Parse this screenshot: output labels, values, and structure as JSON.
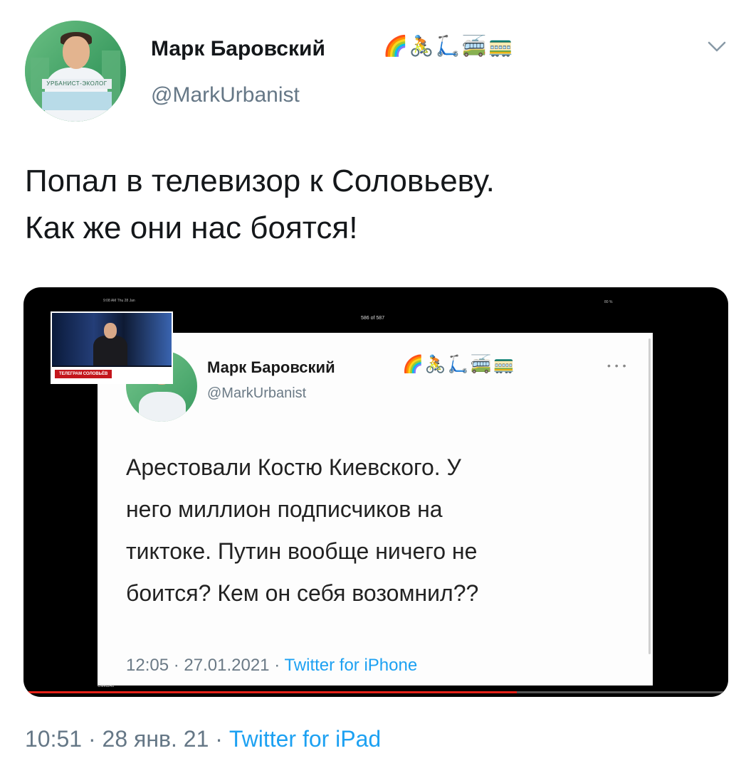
{
  "author": {
    "name": "Марк Баровский",
    "emojis": "🌈🚴🛴🚎🚃",
    "handle": "@MarkUrbanist",
    "avatar_badge": "УРБАНИСТ-ЭКОЛОГ"
  },
  "tweet": {
    "text": "Попал в телевизор к Соловьеву.\nКак же они нас боятся!",
    "time": "10:51",
    "date": "28 янв. 21",
    "separator": "·",
    "source": "Twitter for iPad"
  },
  "media": {
    "status_left": "9:08 AM  Thu 28 Jan",
    "status_mid": "586 of 587",
    "status_right": "80 %",
    "inset_label": "ТЕЛЕГРАМ СОЛОВЬЁВ",
    "bottom_caption": "Смешно",
    "progress": 0.7,
    "embedded_tweet": {
      "name": "Марк Баровский",
      "emojis": "🌈🚴🛴🚎🚃",
      "handle": "@MarkUrbanist",
      "text": "Арестовали Костю Киевского. У\nнего миллион подписчиков на\nтиктоке. Путин вообще ничего не\nбоится? Кем он себя возомнил??",
      "time": "12:05",
      "date": "27.01.2021",
      "separator": "·",
      "source": "Twitter for iPhone"
    }
  },
  "icons": {
    "more": "chevron-down-icon"
  },
  "colors": {
    "link": "#1da1f2",
    "secondary_text": "#657786",
    "progress": "#e62117"
  }
}
